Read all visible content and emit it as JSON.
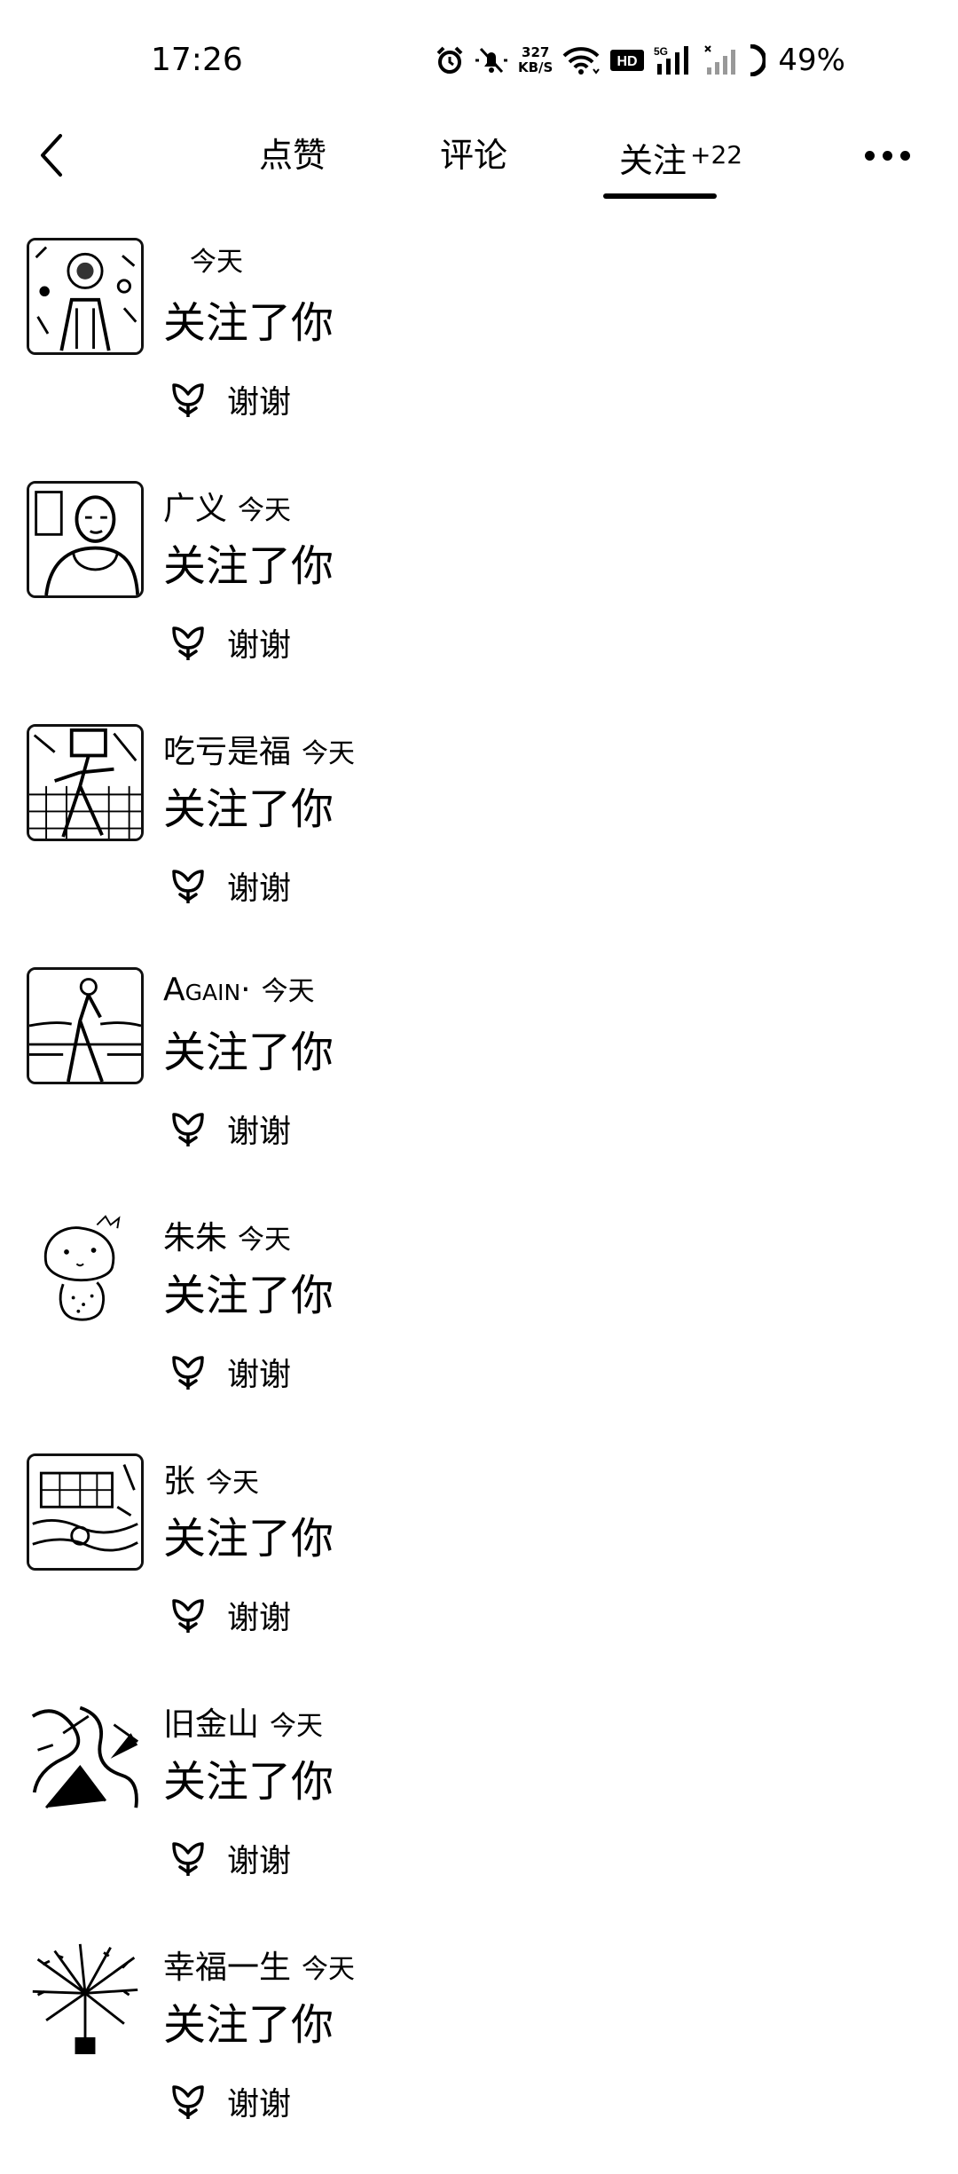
{
  "status_bar": {
    "time": "17:26",
    "net_speed_value": "327",
    "net_speed_unit": "KB/S",
    "hd_label": "HD",
    "network_label": "5G",
    "battery_percent": "49%"
  },
  "header": {
    "tabs": [
      {
        "label": "点赞"
      },
      {
        "label": "评论"
      },
      {
        "label": "关注",
        "badge": "+22"
      }
    ],
    "active_tab": "关注"
  },
  "notifications": [
    {
      "name": "",
      "time": "今天",
      "action": "关注了你",
      "thanks_label": "谢谢"
    },
    {
      "name": "广义",
      "time": "今天",
      "action": "关注了你",
      "thanks_label": "谢谢"
    },
    {
      "name": "吃亏是福",
      "time": "今天",
      "action": "关注了你",
      "thanks_label": "谢谢"
    },
    {
      "name": "Again·",
      "time": "今天",
      "action": "关注了你",
      "thanks_label": "谢谢"
    },
    {
      "name": "朱朱",
      "time": "今天",
      "action": "关注了你",
      "thanks_label": "谢谢"
    },
    {
      "name": "张",
      "time": "今天",
      "action": "关注了你",
      "thanks_label": "谢谢"
    },
    {
      "name": "旧金山",
      "time": "今天",
      "action": "关注了你",
      "thanks_label": "谢谢"
    },
    {
      "name": "幸福一生",
      "time": "今天",
      "action": "关注了你",
      "thanks_label": "谢谢"
    }
  ],
  "icons": {
    "back": "chevron-left-icon",
    "more": "more-dots-icon",
    "thanks": "flower-icon",
    "alarm": "alarm-icon",
    "mute": "mute-bell-icon",
    "wifi": "wifi-icon",
    "signal": "signal-icon",
    "battery": "battery-icon"
  }
}
